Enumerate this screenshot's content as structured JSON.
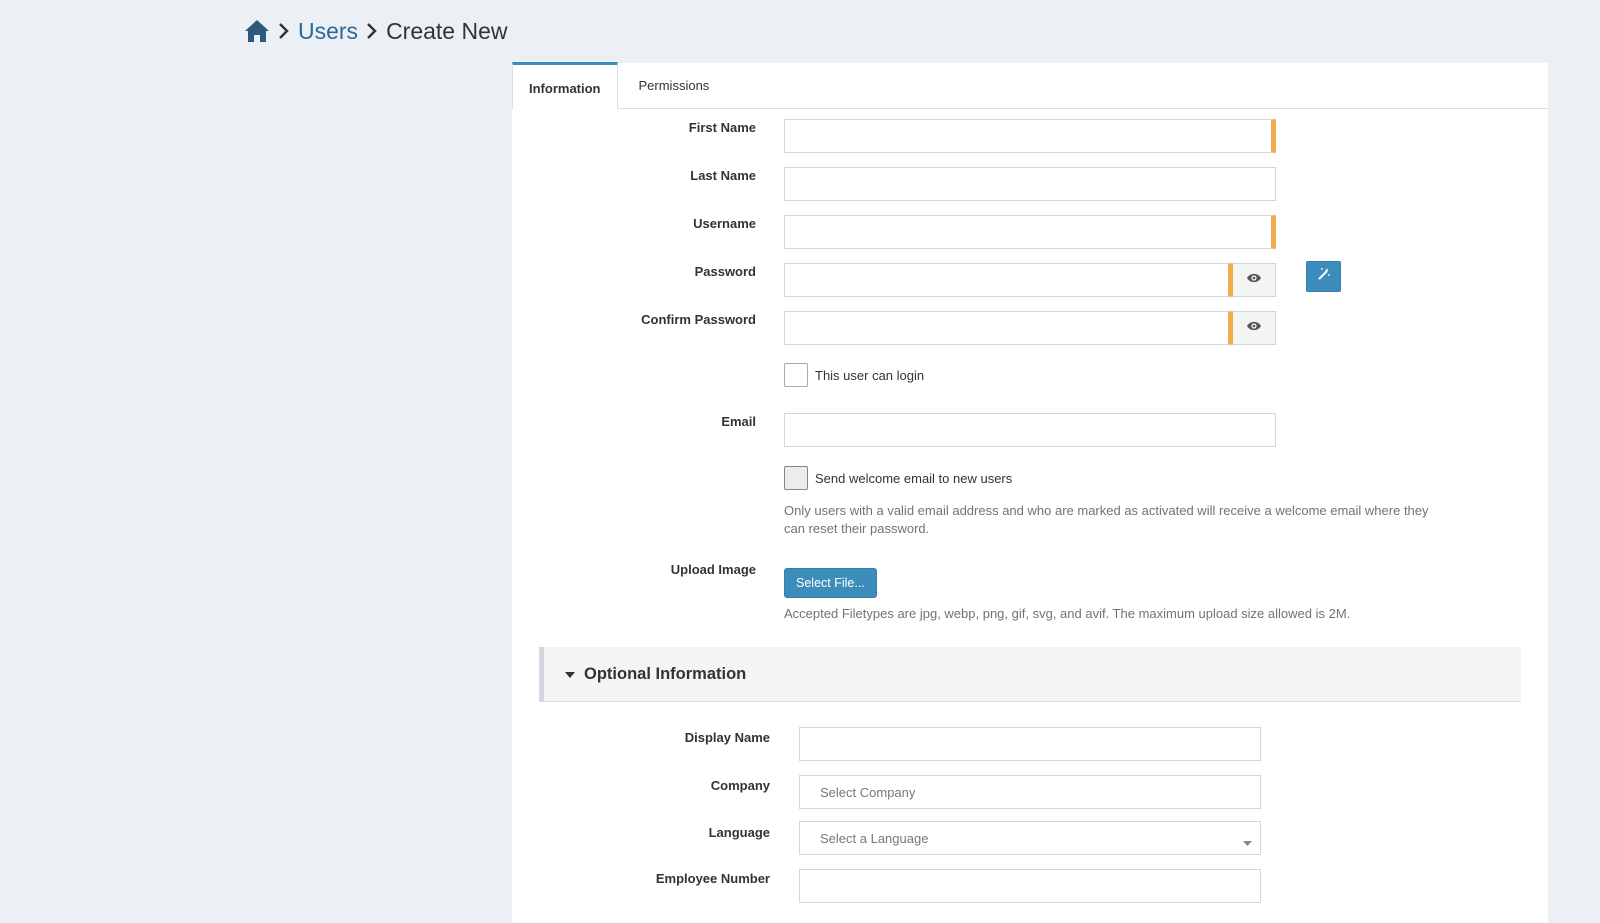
{
  "breadcrumb": {
    "home_icon": "home-icon",
    "items": [
      "Users",
      "Create New"
    ]
  },
  "tabs": [
    "Information",
    "Permissions"
  ],
  "form": {
    "first_name": {
      "label": "First Name",
      "value": ""
    },
    "last_name": {
      "label": "Last Name",
      "value": ""
    },
    "username": {
      "label": "Username",
      "value": ""
    },
    "password": {
      "label": "Password",
      "value": ""
    },
    "confirm_password": {
      "label": "Confirm Password",
      "value": ""
    },
    "can_login": {
      "label": "This user can login",
      "checked": false
    },
    "email": {
      "label": "Email",
      "value": ""
    },
    "send_welcome": {
      "label": "Send welcome email to new users",
      "checked": false,
      "help": "Only users with a valid email address and who are marked as activated will receive a welcome email where they can reset their password."
    },
    "upload_image": {
      "label": "Upload Image",
      "button": "Select File...",
      "help": "Accepted Filetypes are jpg, webp, png, gif, svg, and avif. The maximum upload size allowed is 2M."
    }
  },
  "optional": {
    "title": "Optional Information",
    "display_name": {
      "label": "Display Name",
      "value": ""
    },
    "company": {
      "label": "Company",
      "placeholder": "Select Company"
    },
    "language": {
      "label": "Language",
      "placeholder": "Select a Language"
    },
    "employee_number": {
      "label": "Employee Number",
      "value": ""
    }
  },
  "colors": {
    "accent": "#3c8dbc",
    "required": "#f0ad4e",
    "background": "#ecf0f5"
  }
}
